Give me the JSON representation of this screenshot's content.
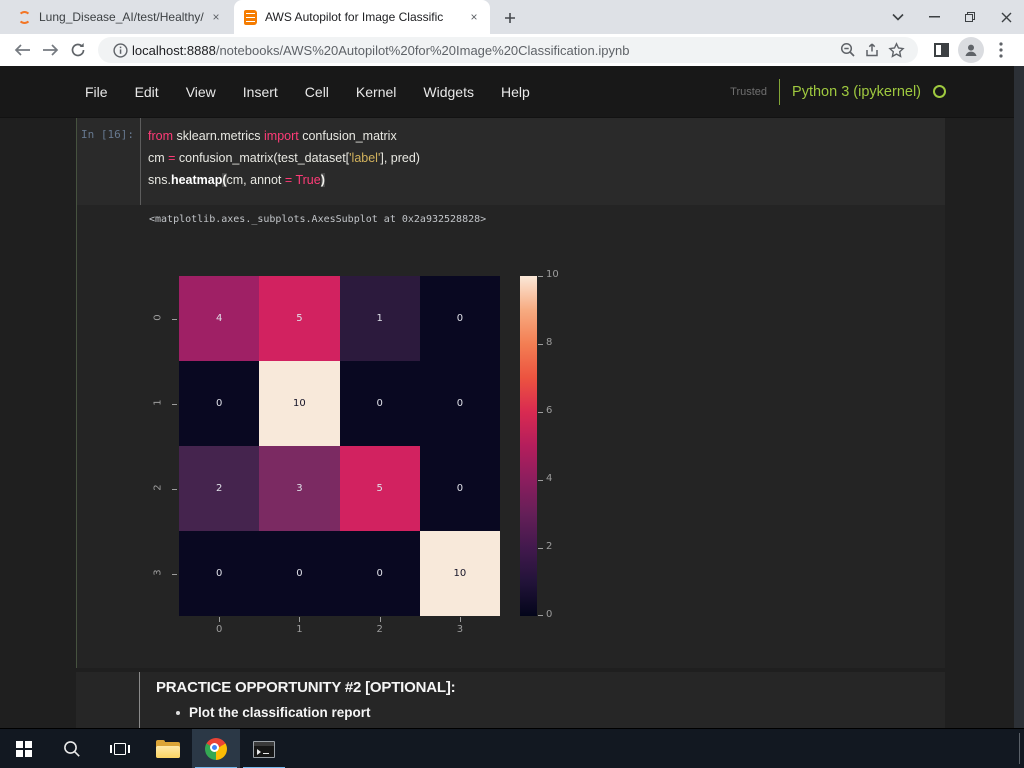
{
  "browser": {
    "tabs": [
      {
        "title": "Lung_Disease_AI/test/Healthy/"
      },
      {
        "title": "AWS Autopilot for Image Classific"
      }
    ],
    "url_host": "localhost:8888",
    "url_path": "/notebooks/AWS%20Autopilot%20for%20Image%20Classification.ipynb"
  },
  "icons": {
    "tab_close": "×",
    "new_tab": "+"
  },
  "jupyter": {
    "menu": [
      "File",
      "Edit",
      "View",
      "Insert",
      "Cell",
      "Kernel",
      "Widgets",
      "Help"
    ],
    "trusted": "Trusted",
    "kernel": "Python 3 (ipykernel)",
    "kernel_color": "#9fc93f",
    "cell": {
      "prompt": "In [16]:",
      "code_lines": [
        [
          {
            "c": "k",
            "t": "from"
          },
          {
            "c": "p",
            "t": " sklearn.metrics "
          },
          {
            "c": "k",
            "t": "import"
          },
          {
            "c": "p",
            "t": " confusion_matrix"
          }
        ],
        [
          {
            "c": "p",
            "t": "cm "
          },
          {
            "c": "k",
            "t": "="
          },
          {
            "c": "p",
            "t": " confusion_matrix(test_dataset["
          },
          {
            "c": "s",
            "t": "'label'"
          },
          {
            "c": "p",
            "t": "], pred)"
          }
        ],
        [
          {
            "c": "p",
            "t": "sns."
          },
          {
            "c": "f",
            "t": "heatmap"
          },
          {
            "c": "b",
            "t": "("
          },
          {
            "c": "p",
            "t": "cm, annot "
          },
          {
            "c": "k",
            "t": "="
          },
          {
            "c": "p",
            "t": " "
          },
          {
            "c": "k",
            "t": "True"
          },
          {
            "c": "b",
            "t": ")"
          }
        ]
      ],
      "output_text": "<matplotlib.axes._subplots.AxesSubplot at 0x2a932528828>"
    },
    "markdown": {
      "heading": "PRACTICE OPPORTUNITY #2 [OPTIONAL]:",
      "bullets": [
        "Plot the classification report"
      ]
    }
  },
  "chart_data": {
    "type": "heatmap",
    "title": "",
    "xlabel": "",
    "ylabel": "",
    "matrix": [
      [
        4,
        5,
        1,
        0
      ],
      [
        0,
        10,
        0,
        0
      ],
      [
        2,
        3,
        5,
        0
      ],
      [
        0,
        0,
        0,
        10
      ]
    ],
    "x_tick_labels": [
      "0",
      "1",
      "2",
      "3"
    ],
    "y_tick_labels": [
      "0",
      "1",
      "2",
      "3"
    ],
    "colorbar_ticks": [
      0,
      2,
      4,
      6,
      8,
      10
    ],
    "vmin": 0,
    "vmax": 10,
    "colormap": "rocket",
    "annotations": true,
    "cell_colors": {
      "0": "#090821",
      "1": "#2c1a3d",
      "2": "#45244e",
      "3": "#7b2a62",
      "4": "#9f2065",
      "5": "#d22260",
      "10": "#f8e9da"
    },
    "annot_light": "#dfe0e8",
    "annot_dark": "#17162a",
    "annot_dark_min": 8
  }
}
